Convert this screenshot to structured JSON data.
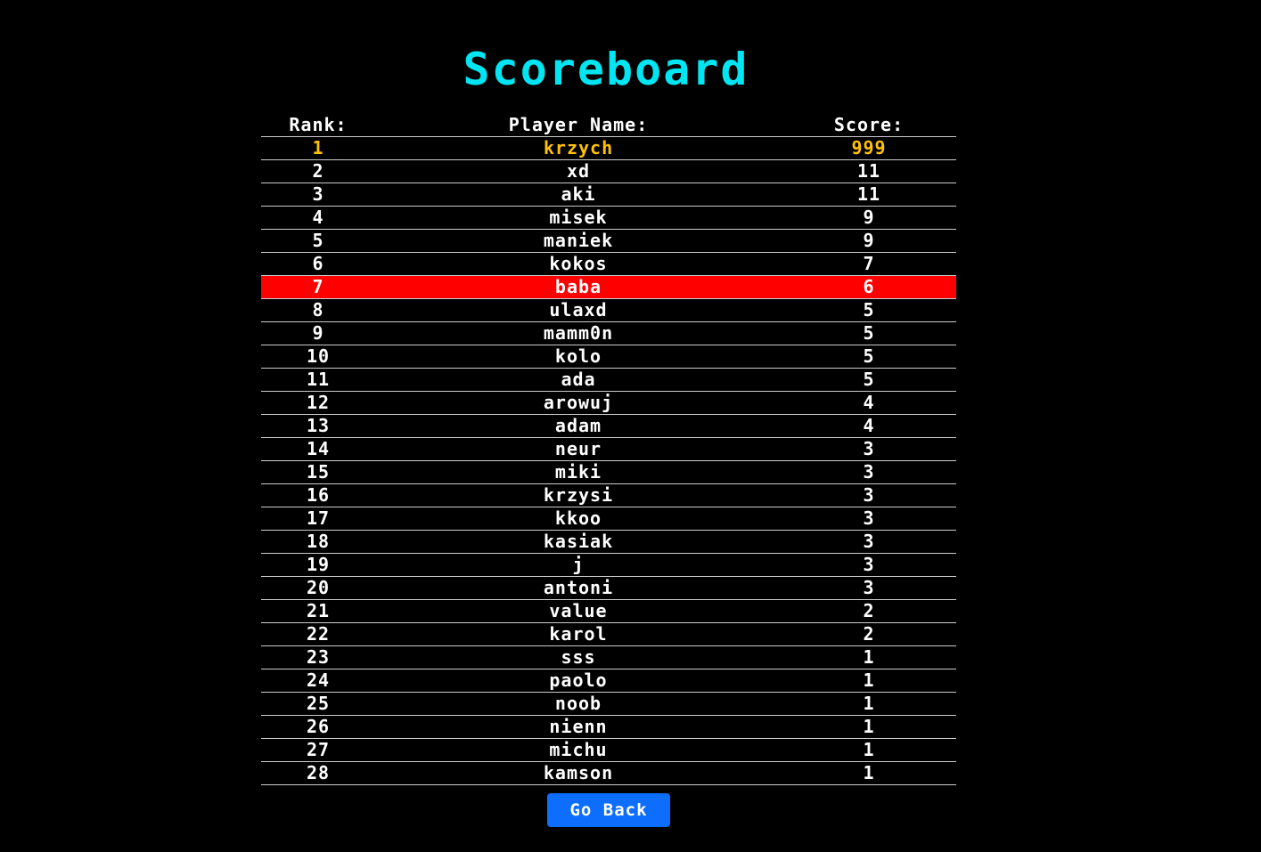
{
  "page": {
    "title": "Scoreboard",
    "title_color": "#00e5f2"
  },
  "table": {
    "headers": {
      "rank": "Rank:",
      "name": "Player Name:",
      "score": "Score:"
    },
    "first_place_color": "#ffc107",
    "highlight_color": "#ff0000",
    "highlighted_rank": "7",
    "rows": [
      {
        "rank": "1",
        "name": "krzych",
        "score": "999"
      },
      {
        "rank": "2",
        "name": "xd",
        "score": "11"
      },
      {
        "rank": "3",
        "name": "aki",
        "score": "11"
      },
      {
        "rank": "4",
        "name": "misek",
        "score": "9"
      },
      {
        "rank": "5",
        "name": "maniek",
        "score": "9"
      },
      {
        "rank": "6",
        "name": "kokos",
        "score": "7"
      },
      {
        "rank": "7",
        "name": "baba",
        "score": "6"
      },
      {
        "rank": "8",
        "name": "ulaxd",
        "score": "5"
      },
      {
        "rank": "9",
        "name": "mamm0n",
        "score": "5"
      },
      {
        "rank": "10",
        "name": "kolo",
        "score": "5"
      },
      {
        "rank": "11",
        "name": "ada",
        "score": "5"
      },
      {
        "rank": "12",
        "name": "arowuj",
        "score": "4"
      },
      {
        "rank": "13",
        "name": "adam",
        "score": "4"
      },
      {
        "rank": "14",
        "name": "neur",
        "score": "3"
      },
      {
        "rank": "15",
        "name": "miki",
        "score": "3"
      },
      {
        "rank": "16",
        "name": "krzysi",
        "score": "3"
      },
      {
        "rank": "17",
        "name": "kkoo",
        "score": "3"
      },
      {
        "rank": "18",
        "name": "kasiak",
        "score": "3"
      },
      {
        "rank": "19",
        "name": "j",
        "score": "3"
      },
      {
        "rank": "20",
        "name": "antoni",
        "score": "3"
      },
      {
        "rank": "21",
        "name": "value",
        "score": "2"
      },
      {
        "rank": "22",
        "name": "karol",
        "score": "2"
      },
      {
        "rank": "23",
        "name": "sss",
        "score": "1"
      },
      {
        "rank": "24",
        "name": "paolo",
        "score": "1"
      },
      {
        "rank": "25",
        "name": "noob",
        "score": "1"
      },
      {
        "rank": "26",
        "name": "nienn",
        "score": "1"
      },
      {
        "rank": "27",
        "name": "michu",
        "score": "1"
      },
      {
        "rank": "28",
        "name": "kamson",
        "score": "1"
      }
    ]
  },
  "actions": {
    "go_back_label": "Go Back",
    "button_color": "#0d6efd"
  }
}
